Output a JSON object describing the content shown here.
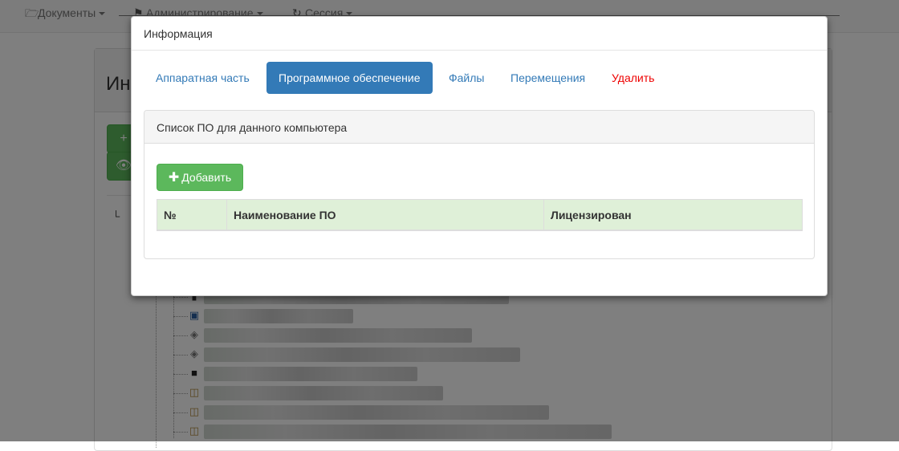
{
  "navbar": {
    "items": [
      {
        "label": "Документы",
        "icon": "folder-open-icon"
      },
      {
        "label": "Администрирование",
        "icon": "flag-icon"
      },
      {
        "label": "Сессия",
        "icon": "refresh-icon"
      }
    ]
  },
  "background": {
    "title_fragment": "Ин"
  },
  "modal": {
    "title": "Информация",
    "tabs": [
      {
        "label": "Аппаратная часть",
        "state": "default"
      },
      {
        "label": "Программное обеспечение",
        "state": "active"
      },
      {
        "label": "Файлы",
        "state": "default"
      },
      {
        "label": "Перемещения",
        "state": "default"
      },
      {
        "label": "Удалить",
        "state": "danger"
      }
    ],
    "panel": {
      "title": "Список ПО для данного компьютера",
      "add_button_label": "Добавить",
      "add_button_icon": "plus-icon",
      "table": {
        "columns": [
          "№",
          "Наименование ПО",
          "Лицензирован"
        ],
        "rows": []
      }
    }
  },
  "colors": {
    "primary": "#337ab7",
    "success": "#5cb85c",
    "danger": "#e00000",
    "table_header_bg": "#dff0d8"
  }
}
